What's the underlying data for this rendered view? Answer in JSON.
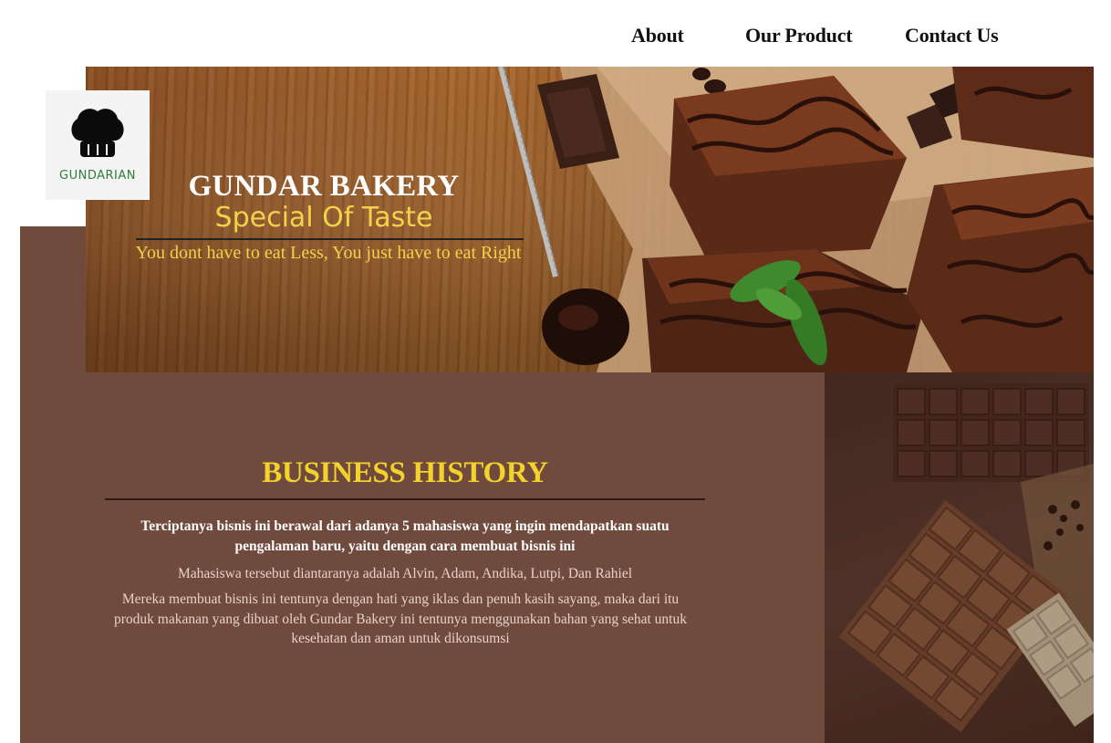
{
  "nav": {
    "about": "About",
    "products": "Our Product",
    "contact": "Contact Us"
  },
  "logo": {
    "text": "GUNDARIAN",
    "icon": "chef-hat-icon"
  },
  "hero": {
    "title": "GUNDAR BAKERY",
    "tagline": "Special Of Taste",
    "subtitle": "You dont have to eat Less, You just have to eat Right"
  },
  "history": {
    "title": "BUSINESS HISTORY",
    "paragraph1": "Terciptanya bisnis ini berawal dari adanya 5 mahasiswa yang ingin mendapatkan suatu pengalaman baru, yaitu dengan cara membuat bisnis ini",
    "paragraph2": "Mahasiswa tersebut diantaranya adalah Alvin, Adam, Andika, Lutpi, Dan Rahiel",
    "paragraph3": "Mereka membuat bisnis ini tentunya dengan hati yang iklas dan penuh kasih sayang, maka dari itu produk makanan yang dibuat oleh Gundar Bakery ini tentunya menggunakan bahan yang sehat untuk kesehatan dan aman untuk dikonsumsi"
  },
  "colors": {
    "brown_panel": "#714a3e",
    "accent_yellow": "#f2d22b",
    "logo_green": "#2f7d3c"
  }
}
